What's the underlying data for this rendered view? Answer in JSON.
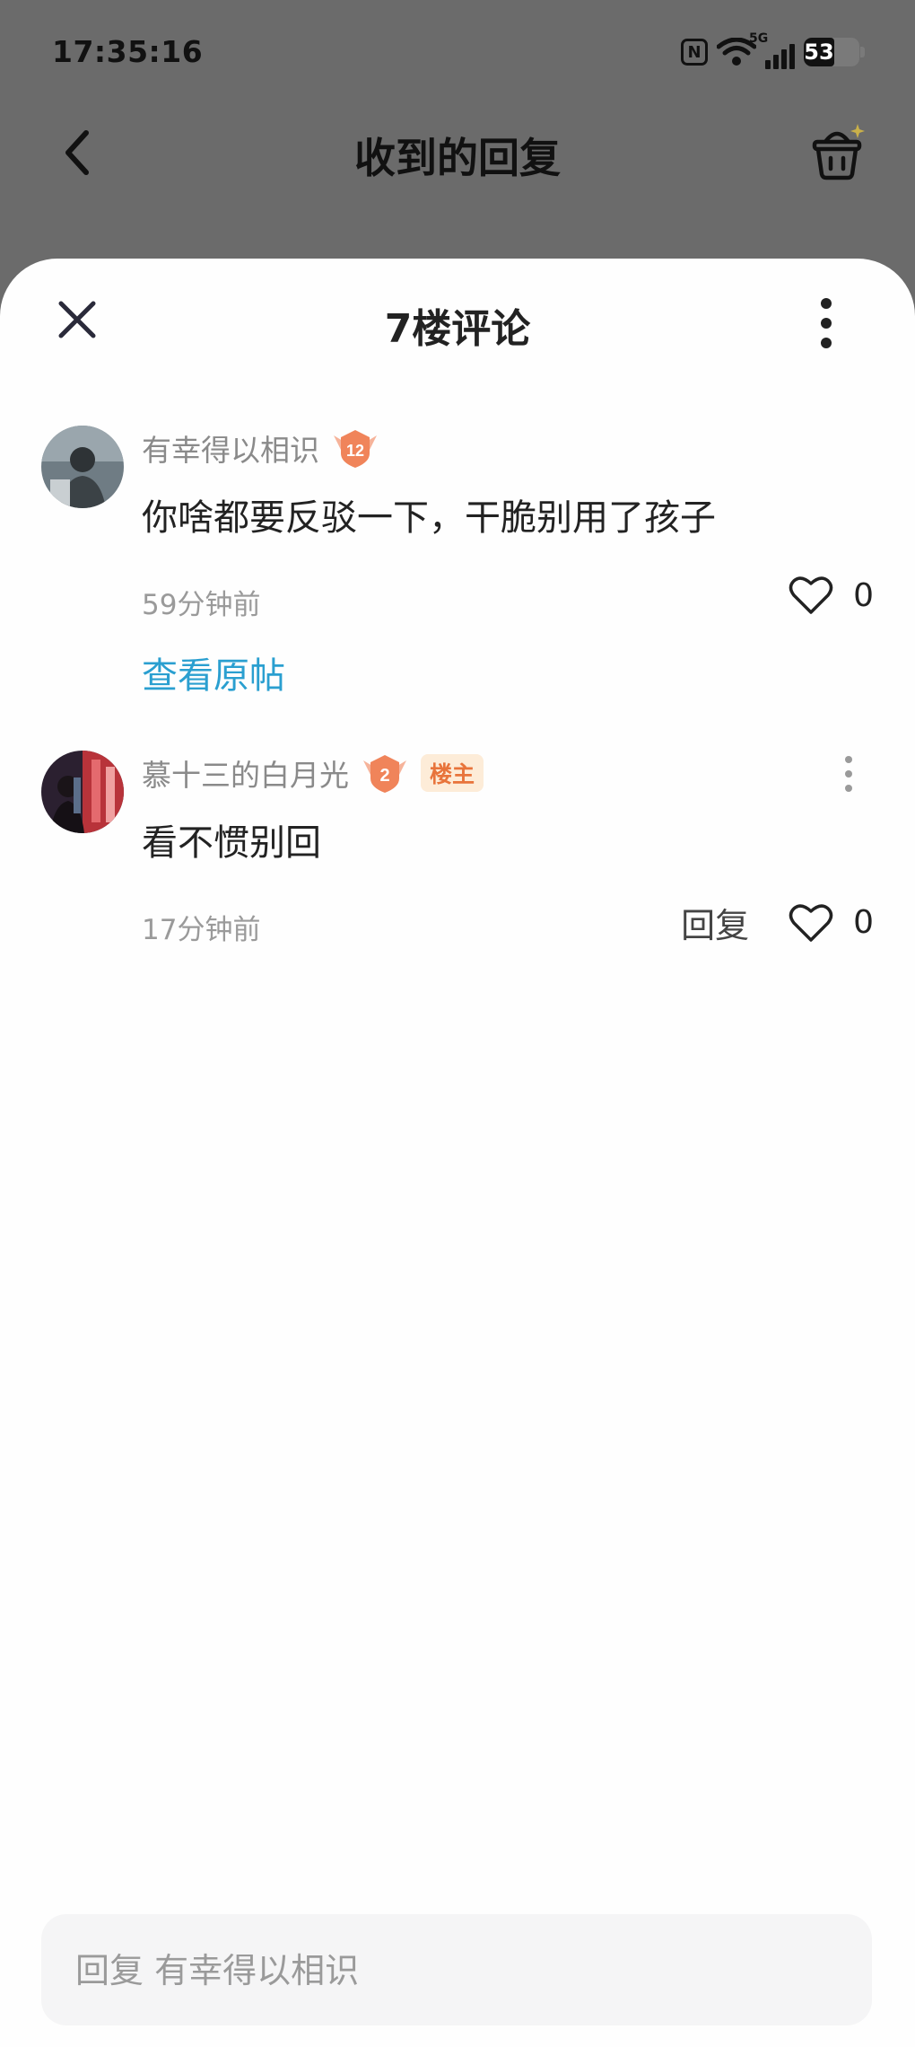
{
  "status_bar": {
    "time": "17:35:16",
    "battery": "53",
    "network": "5G"
  },
  "background": {
    "title": "收到的回复"
  },
  "sheet": {
    "title": "7楼评论"
  },
  "comments": [
    {
      "username": "有幸得以相识",
      "level": "12",
      "content": "你啥都要反驳一下，干脆别用了孩子",
      "time": "59分钟前",
      "likes": "0",
      "view_post": "查看原帖"
    },
    {
      "username": "慕十三的白月光",
      "level": "2",
      "owner_tag": "楼主",
      "content": "看不惯别回",
      "time": "17分钟前",
      "reply": "回复",
      "likes": "0"
    }
  ],
  "reply_bar": {
    "placeholder": "回复 有幸得以相识"
  },
  "colors": {
    "link": "#2a9fd0",
    "owner_tag_text": "#e8743b",
    "owner_tag_bg": "#fdecd8",
    "badge": "#f0845a"
  }
}
